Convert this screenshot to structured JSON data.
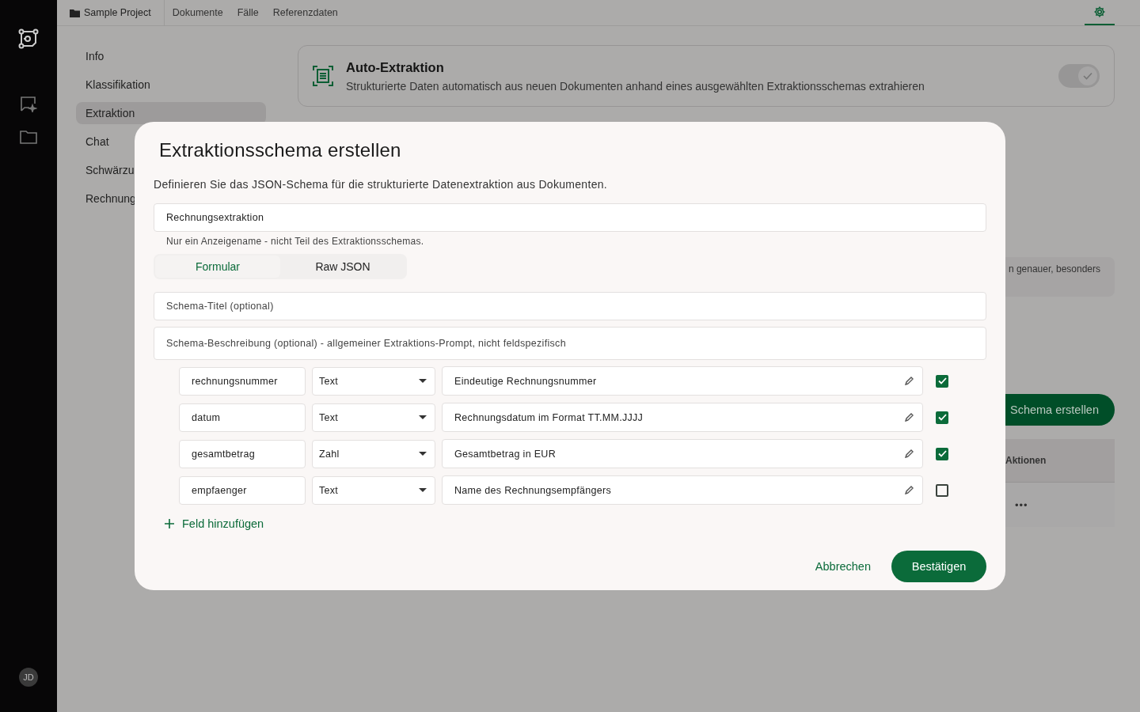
{
  "rail": {
    "avatar": "JD"
  },
  "topbar": {
    "project": "Sample Project",
    "tabs": [
      {
        "label": "Dokumente",
        "selected": false
      },
      {
        "label": "Fälle",
        "selected": false
      },
      {
        "label": "Referenzdaten",
        "selected": false
      }
    ],
    "settings_selected": true
  },
  "settings_nav": [
    {
      "label": "Info",
      "selected": false
    },
    {
      "label": "Klassifikation",
      "selected": false
    },
    {
      "label": "Extraktion",
      "selected": true
    },
    {
      "label": "Chat",
      "selected": false
    },
    {
      "label": "Schwärzu",
      "selected": false
    },
    {
      "label": "Rechnung",
      "selected": false
    }
  ],
  "auto_extraction": {
    "title": "Auto-Extraktion",
    "description": "Strukturierte Daten automatisch aus neuen Dokumenten anhand eines ausgewählten Extraktionsschemas extrahieren",
    "on": true
  },
  "hint_text": "n genauer, besonders",
  "create_button": "Schema erstellen",
  "table": {
    "columns": [
      "Aktionen"
    ],
    "rows": [
      {
        "actions": "•••"
      }
    ]
  },
  "dialog": {
    "title": "Extraktionsschema erstellen",
    "description": "Definieren Sie das JSON-Schema für die strukturierte Datenextraktion aus Dokumenten.",
    "name_value": "Rechnungsextraktion",
    "name_hint": "Nur ein Anzeigename - nicht Teil des Extraktionsschemas.",
    "view_tabs": [
      {
        "label": "Formular",
        "selected": true
      },
      {
        "label": "Raw JSON",
        "selected": false
      }
    ],
    "schema_title": {
      "placeholder": "Schema-Titel (optional)"
    },
    "schema_description": {
      "placeholder": "Schema-Beschreibung (optional) - allgemeiner Extraktions-Prompt, nicht feldspezifisch"
    },
    "fields": [
      {
        "name": "rechnungsnummer",
        "type": "Text",
        "description": "Eindeutige Rechnungsnummer",
        "required": true
      },
      {
        "name": "datum",
        "type": "Text",
        "description": "Rechnungsdatum im Format TT.MM.JJJJ",
        "required": true
      },
      {
        "name": "gesamtbetrag",
        "type": "Zahl",
        "description": "Gesamtbetrag in EUR",
        "required": true
      },
      {
        "name": "empfaenger",
        "type": "Text",
        "description": "Name des Rechnungsempfängers",
        "required": false
      }
    ],
    "add_field": "Feld hinzufügen",
    "cancel": "Abbrechen",
    "confirm": "Bestätigen"
  }
}
